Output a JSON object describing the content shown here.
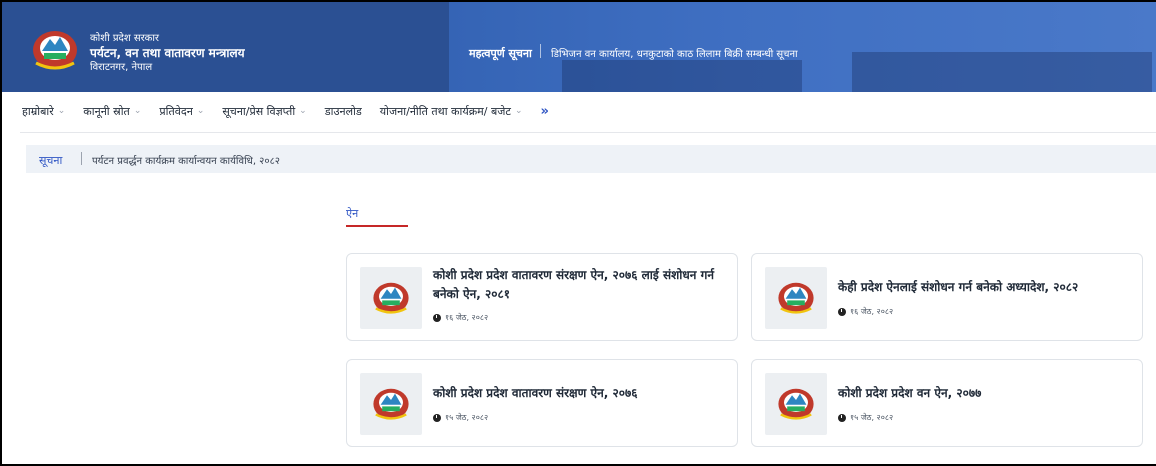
{
  "header": {
    "org_line1": "कोशी प्रदेश सरकार",
    "org_line2": "पर्यटन, वन तथा वातावरण मन्त्रालय",
    "org_line3": "विराटनगर, नेपाल",
    "important_label": "महत्वपूर्ण सूचना",
    "important_text": "डिभिजन वन कार्यालय, धनकुटाको काठ लिलाम बिक्री सम्बन्धी सूचना",
    "emblem_icon": "nepal-emblem-icon"
  },
  "nav": {
    "items": [
      {
        "label": "हाम्रोबारे"
      },
      {
        "label": "कानूनी स्रोत"
      },
      {
        "label": "प्रतिवेदन"
      },
      {
        "label": "सूचना/प्रेस विज्ञप्ती"
      },
      {
        "label": "डाउनलोड"
      },
      {
        "label": "योजना/नीति तथा कार्यक्रम/ बजेट"
      }
    ],
    "more": "»"
  },
  "notice": {
    "label": "सूचना",
    "text": "पर्यटन प्रवर्द्धन कार्यक्रम कार्यान्वयन कार्यविधि, २०८२"
  },
  "section": {
    "title": "ऐन"
  },
  "cards": [
    {
      "title": "कोशी प्रदेश प्रदेश वातावरण संरक्षण ऐन, २०७६ लाई संशोधन गर्न बनेको ऐन, २०८१",
      "date": "१६ जेठ, २०८२"
    },
    {
      "title": "केही प्रदेश ऐनलाई संशोधन गर्न बनेको अध्यादेश, २०८२",
      "date": "१६ जेठ, २०८२"
    },
    {
      "title": "कोशी प्रदेश प्रदेश वातावरण संरक्षण ऐन, २०७६",
      "date": "१५ जेठ, २०८२"
    },
    {
      "title": "कोशी प्रदेश प्रदेश वन ऐन, २०७७",
      "date": "१५ जेठ, २०८२"
    }
  ],
  "colors": {
    "header_bg": "#2f5597",
    "accent_blue": "#2f55c4",
    "accent_red": "#c62828"
  }
}
